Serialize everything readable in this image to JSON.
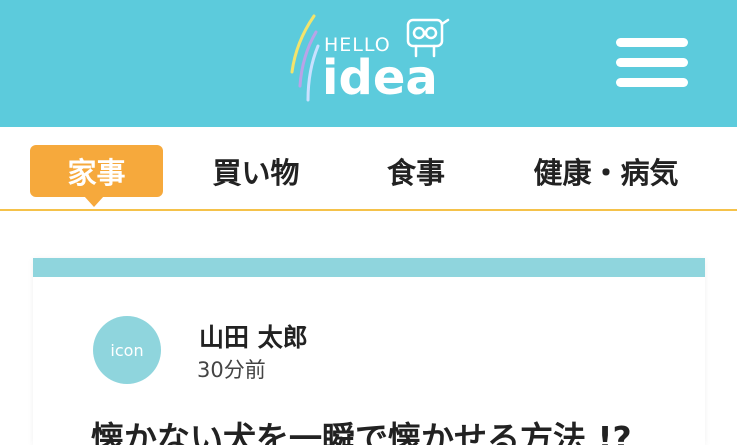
{
  "header": {
    "logo_small_text": "HELLO",
    "logo_main_text": "idea",
    "menu_icon": "hamburger-menu-icon",
    "background_color": "#5ccbdc"
  },
  "tabs": [
    {
      "label": "家事",
      "active": true
    },
    {
      "label": "買い物",
      "active": false
    },
    {
      "label": "食事",
      "active": false
    },
    {
      "label": "健康・病気",
      "active": false
    }
  ],
  "colors": {
    "active_tab": "#f6a93c",
    "tab_underline": "#f5c24a",
    "card_accent": "#8fd5dd"
  },
  "post": {
    "avatar_text": "icon",
    "author": "山田 太郎",
    "time": "30分前",
    "title": "懐かない犬を一瞬で懐かせる方法 !?"
  }
}
